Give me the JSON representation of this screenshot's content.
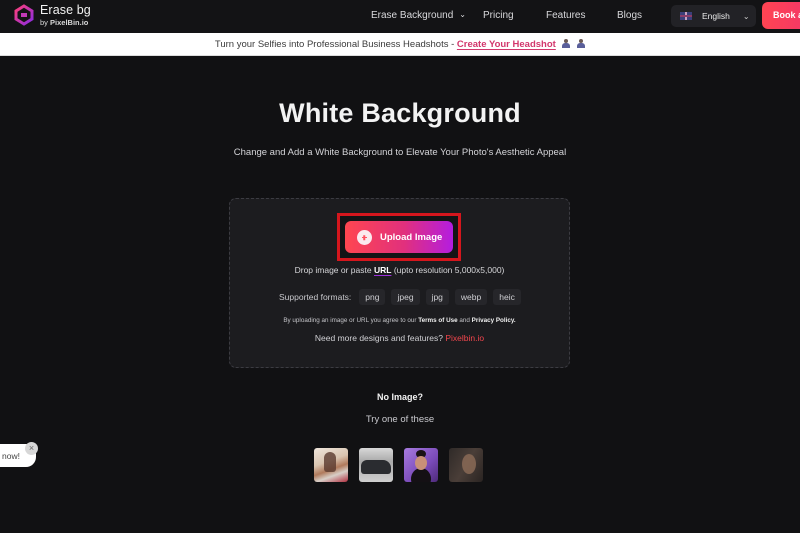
{
  "header": {
    "logo_title": "Erase bg",
    "logo_sub_prefix": "by",
    "logo_sub_brand": "PixelBin.io",
    "nav": [
      {
        "label": "Erase Background",
        "has_dropdown": true
      },
      {
        "label": "Pricing"
      },
      {
        "label": "Features"
      },
      {
        "label": "Blogs"
      }
    ],
    "language": {
      "selected": "English",
      "flag": "uk-flag-icon"
    },
    "cta_label": "Book a"
  },
  "announcement": {
    "text": "Turn your Selfies into Professional Business Headshots - ",
    "link": "Create Your Headshot",
    "icons": [
      "person-woman-icon",
      "person-man-icon"
    ]
  },
  "hero": {
    "title": "White Background",
    "subtitle": "Change and Add a White Background to Elevate Your Photo's Aesthetic Appeal"
  },
  "upload": {
    "button_label": "Upload Image",
    "drop_prefix": "Drop image or paste ",
    "drop_url": "URL",
    "drop_suffix": " (upto resolution 5,000x5,000)",
    "formats_label": "Supported formats:",
    "formats": [
      "png",
      "jpeg",
      "jpg",
      "webp",
      "heic"
    ],
    "terms_prefix": "By uploading an image or URL you agree to our ",
    "terms_link": "Terms of Use",
    "terms_and": " and ",
    "privacy_link": "Privacy Policy.",
    "more_prefix": "Need more designs and features? ",
    "more_link": "Pixelbin.io",
    "colors": {
      "highlight_border": "#d5161d",
      "gradient_start": "#ff4650",
      "gradient_end": "#b41de0"
    }
  },
  "samples": {
    "heading": "No Image?",
    "subheading": "Try one of these",
    "items": [
      {
        "name": "sample-woman-outdoor"
      },
      {
        "name": "sample-car"
      },
      {
        "name": "sample-woman-purple"
      },
      {
        "name": "sample-man-portrait"
      }
    ]
  },
  "toast": {
    "text": "now!",
    "close": "×"
  }
}
